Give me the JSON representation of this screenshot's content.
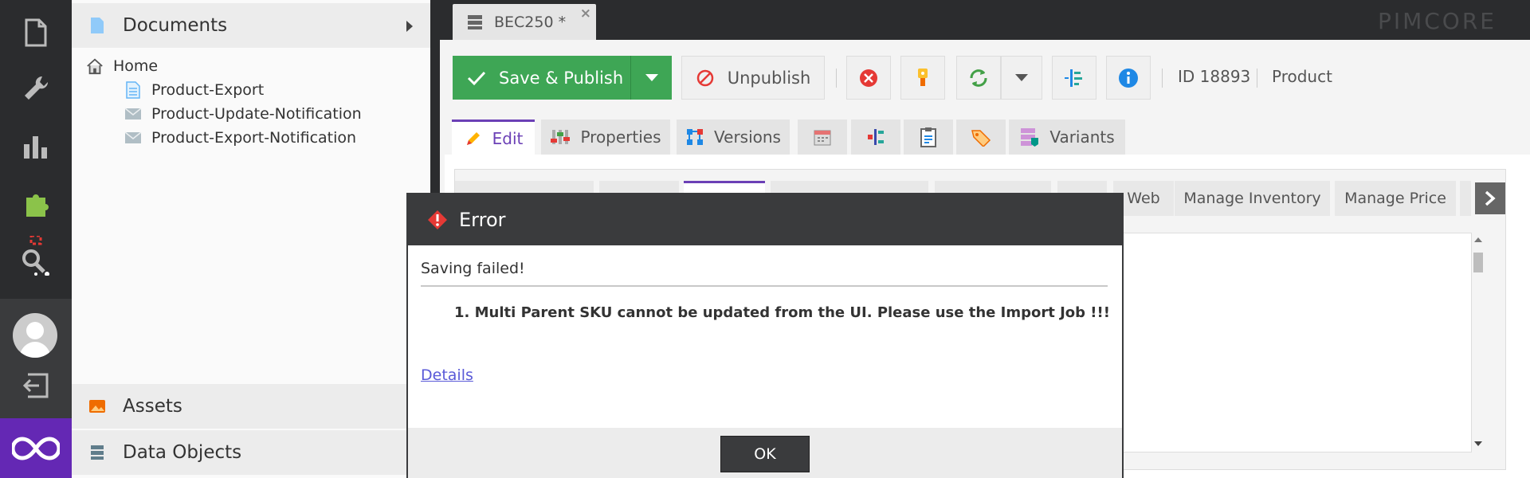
{
  "rail": {
    "icons": [
      "document-icon",
      "wrench-icon",
      "bar-chart-icon",
      "puzzle-icon",
      "search-icon",
      "user-avatar-icon",
      "logout-icon",
      "pimcore-logo-icon"
    ]
  },
  "tree": {
    "documents_label": "Documents",
    "nodes": [
      {
        "label": "Home"
      },
      {
        "label": "Product-Export"
      },
      {
        "label": "Product-Update-Notification"
      },
      {
        "label": "Product-Export-Notification"
      }
    ],
    "assets_label": "Assets",
    "data_objects_label": "Data Objects"
  },
  "editor": {
    "tab_title": "BEC250 *",
    "brand": "PIMCORE"
  },
  "toolbar": {
    "save_publish_label": "Save & Publish",
    "unpublish_label": "Unpublish",
    "id_label": "ID 18893",
    "type_label": "Product"
  },
  "edit_tabs": {
    "edit": "Edit",
    "properties": "Properties",
    "versions": "Versions",
    "variants": "Variants"
  },
  "inner_tabs": {
    "web": "Web",
    "manage_inventory": "Manage Inventory",
    "manage_price": "Manage Price"
  },
  "modal": {
    "title": "Error",
    "message": "Saving failed!",
    "detail": "1. Multi Parent SKU cannot be updated from the UI. Please use the Import Job !!!",
    "details_link": "Details",
    "ok_label": "OK"
  },
  "colors": {
    "accent": "#6b40b6",
    "save_green": "#3ea655",
    "error_red": "#e53935",
    "rail_bg": "#2b2c2e",
    "logo_bg": "#6428b4"
  }
}
